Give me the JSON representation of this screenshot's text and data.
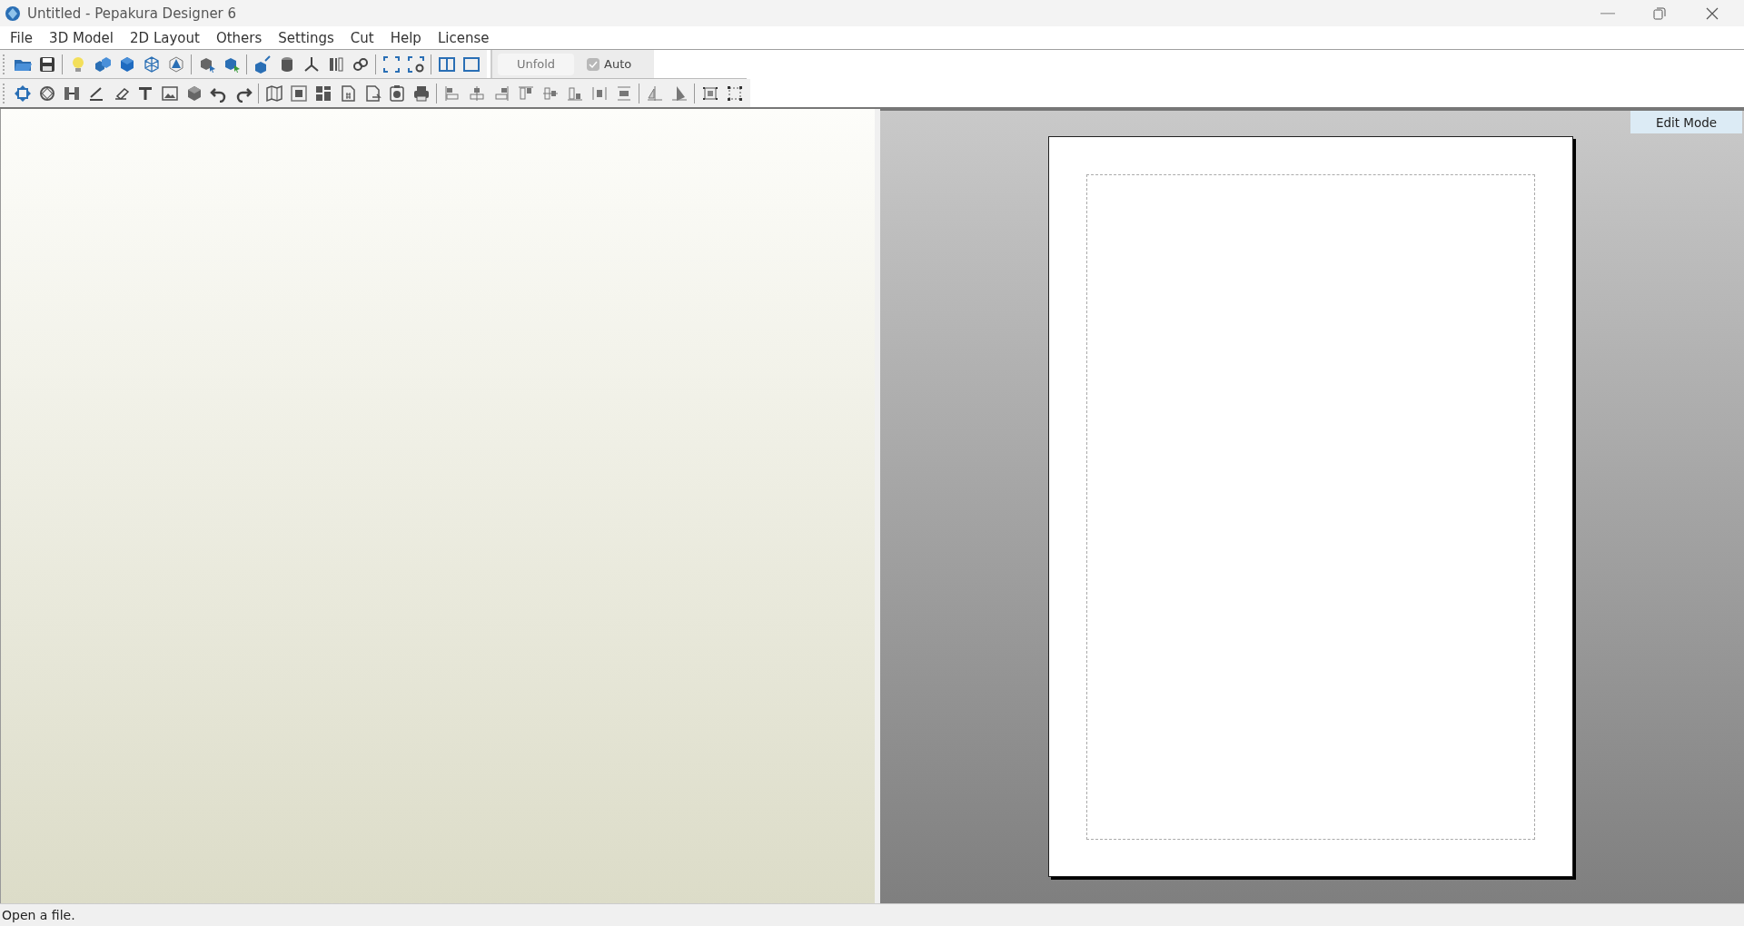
{
  "window": {
    "title": "Untitled - Pepakura Designer 6"
  },
  "menu": [
    "File",
    "3D Model",
    "2D Layout",
    "Others",
    "Settings",
    "Cut",
    "Help",
    "License"
  ],
  "toolbar": {
    "unfold": {
      "label": "Unfold",
      "disabled": true
    },
    "auto": {
      "label": "Auto",
      "checked": true,
      "disabled": true
    }
  },
  "layout_view": {
    "mode_label": "Edit Mode"
  },
  "status_bar": {
    "text": "Open a file."
  }
}
